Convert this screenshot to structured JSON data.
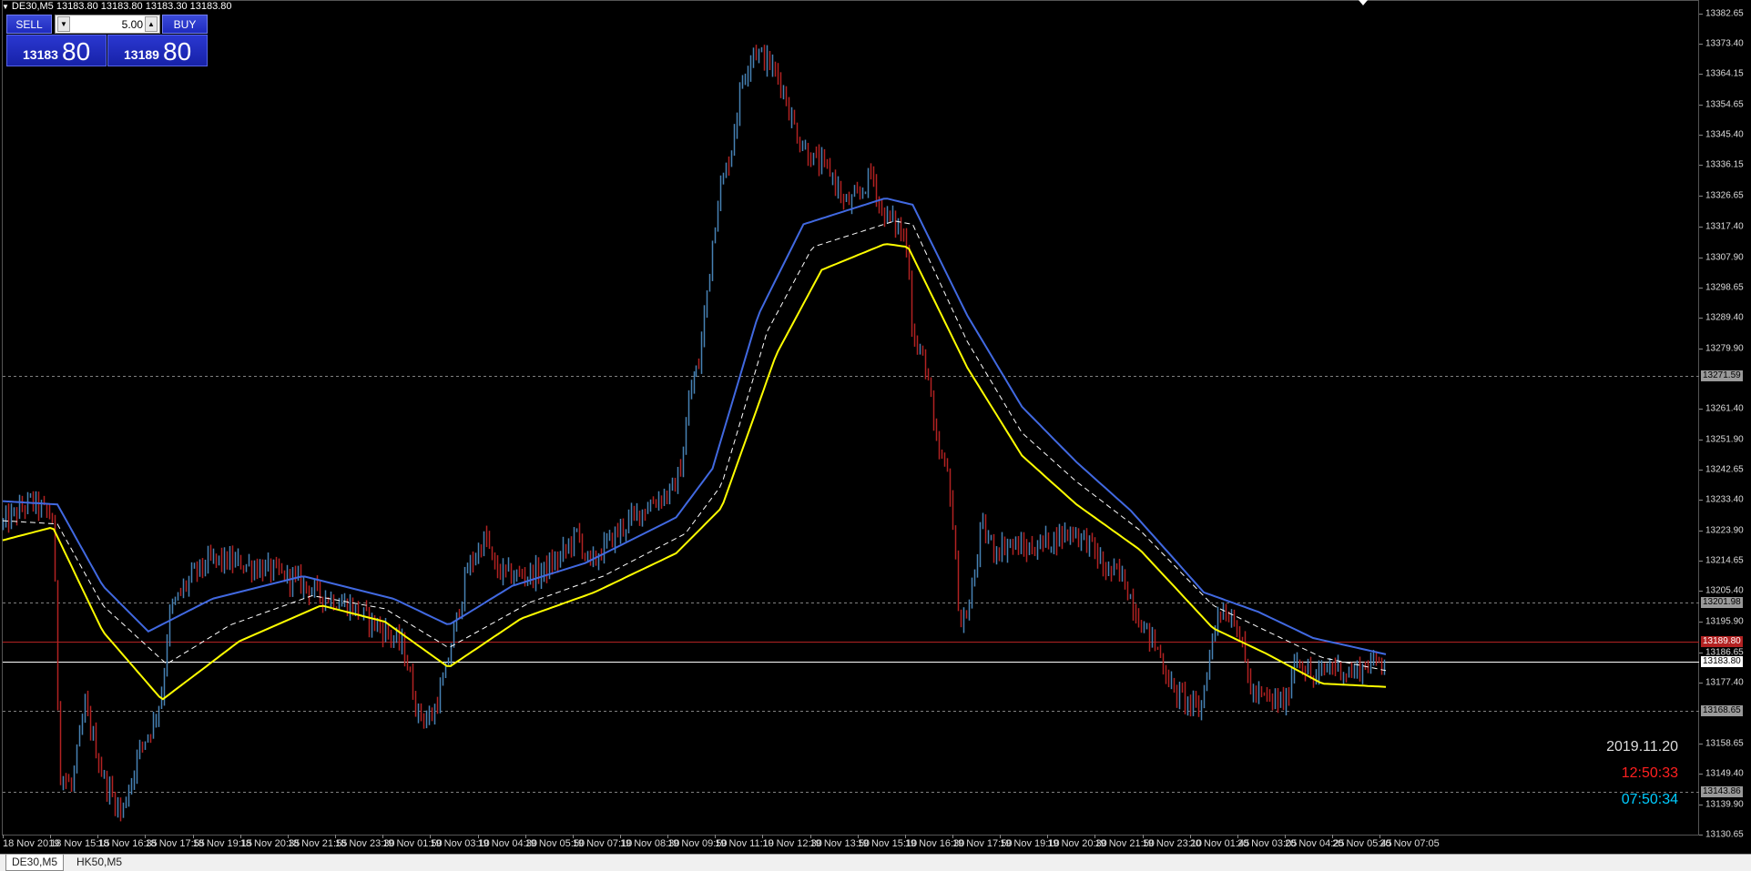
{
  "window": {
    "title": "DE30,M5  13183.80 13183.80 13183.30 13183.80"
  },
  "trade_panel": {
    "sell_label": "SELL",
    "buy_label": "BUY",
    "lot_value": "5.00",
    "sell_price_small": "13183",
    "sell_price_big": "80",
    "buy_price_small": "13189",
    "buy_price_big": "80"
  },
  "price_scale": {
    "ticks": [
      "13382.65",
      "13373.40",
      "13364.15",
      "13354.65",
      "13345.40",
      "13336.15",
      "13326.65",
      "13317.40",
      "13307.90",
      "13298.65",
      "13289.40",
      "13279.90",
      "13261.40",
      "13251.90",
      "13242.65",
      "13233.40",
      "13223.90",
      "13214.65",
      "13205.40",
      "13195.90",
      "13186.65",
      "13177.40",
      "13158.65",
      "13149.40",
      "13139.90",
      "13130.65"
    ],
    "tags": {
      "level_13271": "13271.59",
      "level_13201": "13201.98",
      "bid_red": "13189.80",
      "bid_white": "13183.80",
      "level_13168": "13168.65",
      "level_13143": "13143.86"
    }
  },
  "time_axis": {
    "labels": [
      "18 Nov 2019",
      "18 Nov 15:15",
      "18 Nov 16:35",
      "18 Nov 17:55",
      "18 Nov 19:15",
      "18 Nov 20:35",
      "18 Nov 21:55",
      "18 Nov 23:30",
      "19 Nov 01:50",
      "19 Nov 03:10",
      "19 Nov 04:30",
      "19 Nov 05:50",
      "19 Nov 07:10",
      "19 Nov 08:30",
      "19 Nov 09:50",
      "19 Nov 11:10",
      "19 Nov 12:30",
      "19 Nov 13:50",
      "19 Nov 15:10",
      "19 Nov 16:30",
      "19 Nov 17:50",
      "19 Nov 19:10",
      "19 Nov 20:30",
      "19 Nov 21:50",
      "19 Nov 23:10",
      "20 Nov 01:45",
      "20 Nov 03:05",
      "20 Nov 04:25",
      "20 Nov 05:45",
      "20 Nov 07:05"
    ]
  },
  "clock": {
    "date": "2019.11.20",
    "time_red": "12:50:33",
    "time_cyan": "07:50:34"
  },
  "tabs": [
    {
      "label": "DE30,M5",
      "active": true
    },
    {
      "label": "HK50,M5",
      "active": false
    }
  ],
  "colors": {
    "background": "#000000",
    "bull_bar": "#4682b4",
    "bear_bar": "#b22222",
    "band_upper": "#4169e1",
    "band_lower": "#ffff00",
    "band_mid": "#ffffff",
    "clock_date": "#dddddd",
    "clock_red": "#ff0000",
    "clock_cyan": "#00ccff"
  },
  "chart_data": {
    "type": "line",
    "symbol": "DE30",
    "timeframe": "M5",
    "ylim": [
      13130.65,
      13386.0
    ],
    "price_keyframes": [
      [
        0,
        13226
      ],
      [
        30,
        13233
      ],
      [
        55,
        13228
      ],
      [
        62,
        13150
      ],
      [
        75,
        13145
      ],
      [
        90,
        13170
      ],
      [
        110,
        13148
      ],
      [
        130,
        13137
      ],
      [
        150,
        13157
      ],
      [
        165,
        13165
      ],
      [
        175,
        13175
      ],
      [
        182,
        13198
      ],
      [
        195,
        13205
      ],
      [
        210,
        13211
      ],
      [
        230,
        13215
      ],
      [
        260,
        13214
      ],
      [
        290,
        13212
      ],
      [
        320,
        13209
      ],
      [
        350,
        13204
      ],
      [
        380,
        13201
      ],
      [
        400,
        13197
      ],
      [
        420,
        13193
      ],
      [
        440,
        13188
      ],
      [
        455,
        13168
      ],
      [
        470,
        13166
      ],
      [
        485,
        13179
      ],
      [
        495,
        13193
      ],
      [
        510,
        13212
      ],
      [
        530,
        13222
      ],
      [
        540,
        13212
      ],
      [
        560,
        13210
      ],
      [
        590,
        13211
      ],
      [
        610,
        13215
      ],
      [
        630,
        13223
      ],
      [
        645,
        13213
      ],
      [
        660,
        13219
      ],
      [
        680,
        13225
      ],
      [
        700,
        13230
      ],
      [
        720,
        13234
      ],
      [
        735,
        13236
      ],
      [
        745,
        13244
      ],
      [
        755,
        13268
      ],
      [
        765,
        13275
      ],
      [
        775,
        13300
      ],
      [
        785,
        13325
      ],
      [
        800,
        13340
      ],
      [
        812,
        13362
      ],
      [
        825,
        13372
      ],
      [
        840,
        13368
      ],
      [
        855,
        13362
      ],
      [
        865,
        13352
      ],
      [
        875,
        13344
      ],
      [
        890,
        13338
      ],
      [
        910,
        13334
      ],
      [
        925,
        13324
      ],
      [
        940,
        13326
      ],
      [
        955,
        13334
      ],
      [
        965,
        13322
      ],
      [
        985,
        13317
      ],
      [
        995,
        13310
      ],
      [
        1000,
        13282
      ],
      [
        1015,
        13275
      ],
      [
        1025,
        13250
      ],
      [
        1040,
        13240
      ],
      [
        1052,
        13195
      ],
      [
        1062,
        13200
      ],
      [
        1075,
        13225
      ],
      [
        1090,
        13218
      ],
      [
        1105,
        13220
      ],
      [
        1125,
        13218
      ],
      [
        1150,
        13221
      ],
      [
        1175,
        13224
      ],
      [
        1195,
        13220
      ],
      [
        1210,
        13212
      ],
      [
        1230,
        13210
      ],
      [
        1250,
        13196
      ],
      [
        1270,
        13187
      ],
      [
        1285,
        13175
      ],
      [
        1300,
        13172
      ],
      [
        1315,
        13168
      ],
      [
        1325,
        13184
      ],
      [
        1335,
        13200
      ],
      [
        1355,
        13197
      ],
      [
        1372,
        13174
      ],
      [
        1390,
        13172
      ],
      [
        1410,
        13171
      ],
      [
        1420,
        13186
      ],
      [
        1440,
        13178
      ],
      [
        1460,
        13183
      ],
      [
        1480,
        13180
      ],
      [
        1500,
        13183
      ],
      [
        1520,
        13185
      ]
    ],
    "band_upper_keyframes": [
      [
        0,
        13233
      ],
      [
        60,
        13232
      ],
      [
        110,
        13207
      ],
      [
        160,
        13193
      ],
      [
        230,
        13203
      ],
      [
        330,
        13210
      ],
      [
        430,
        13203
      ],
      [
        490,
        13195
      ],
      [
        560,
        13207
      ],
      [
        640,
        13214
      ],
      [
        740,
        13228
      ],
      [
        780,
        13243
      ],
      [
        830,
        13290
      ],
      [
        880,
        13318
      ],
      [
        970,
        13326
      ],
      [
        1000,
        13324
      ],
      [
        1060,
        13290
      ],
      [
        1120,
        13262
      ],
      [
        1180,
        13245
      ],
      [
        1240,
        13230
      ],
      [
        1320,
        13205
      ],
      [
        1380,
        13199
      ],
      [
        1440,
        13191
      ],
      [
        1520,
        13186
      ]
    ],
    "band_mid_keyframes": [
      [
        0,
        13227
      ],
      [
        60,
        13226
      ],
      [
        110,
        13201
      ],
      [
        180,
        13183
      ],
      [
        250,
        13195
      ],
      [
        340,
        13204
      ],
      [
        420,
        13200
      ],
      [
        490,
        13188
      ],
      [
        580,
        13202
      ],
      [
        660,
        13210
      ],
      [
        750,
        13223
      ],
      [
        790,
        13238
      ],
      [
        840,
        13285
      ],
      [
        890,
        13311
      ],
      [
        980,
        13319
      ],
      [
        1000,
        13318
      ],
      [
        1060,
        13282
      ],
      [
        1120,
        13254
      ],
      [
        1180,
        13239
      ],
      [
        1250,
        13224
      ],
      [
        1330,
        13201
      ],
      [
        1390,
        13193
      ],
      [
        1450,
        13185
      ],
      [
        1520,
        13181
      ]
    ],
    "band_lower_keyframes": [
      [
        0,
        13221
      ],
      [
        55,
        13225
      ],
      [
        110,
        13193
      ],
      [
        175,
        13172
      ],
      [
        260,
        13190
      ],
      [
        350,
        13201
      ],
      [
        420,
        13196
      ],
      [
        490,
        13182
      ],
      [
        570,
        13197
      ],
      [
        650,
        13205
      ],
      [
        740,
        13217
      ],
      [
        790,
        13231
      ],
      [
        850,
        13278
      ],
      [
        900,
        13304
      ],
      [
        970,
        13312
      ],
      [
        995,
        13311
      ],
      [
        1060,
        13274
      ],
      [
        1120,
        13247
      ],
      [
        1180,
        13232
      ],
      [
        1250,
        13218
      ],
      [
        1330,
        13194
      ],
      [
        1390,
        13186
      ],
      [
        1450,
        13177
      ],
      [
        1520,
        13176
      ]
    ],
    "horizontal_levels": [
      {
        "value": 13271.59,
        "color": "#808080",
        "style": "dotted"
      },
      {
        "value": 13201.98,
        "color": "#808080",
        "style": "dotted"
      },
      {
        "value": 13189.8,
        "color": "#b22222",
        "style": "solid"
      },
      {
        "value": 13183.8,
        "color": "#ffffff",
        "style": "solid"
      },
      {
        "value": 13168.65,
        "color": "#808080",
        "style": "dotted"
      },
      {
        "value": 13143.86,
        "color": "#808080",
        "style": "dotted"
      }
    ]
  }
}
